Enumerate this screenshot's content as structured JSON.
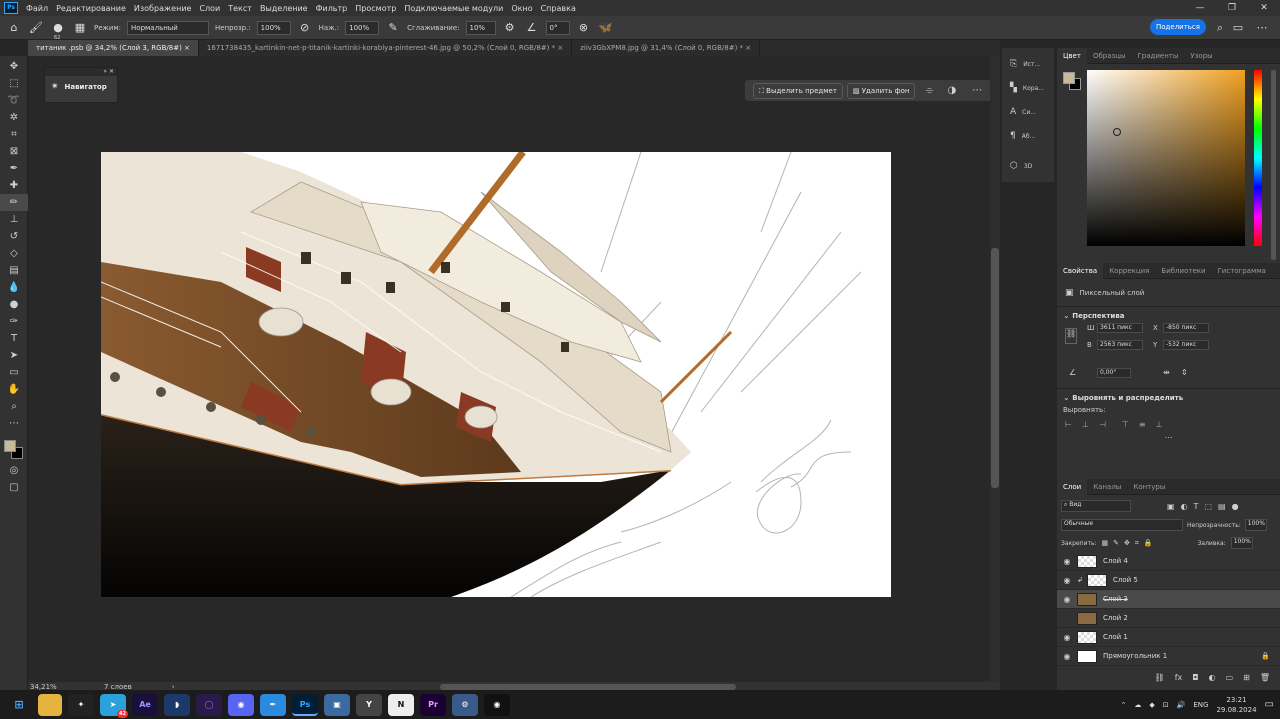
{
  "menubar": {
    "logo": "Ps",
    "items": [
      "Файл",
      "Редактирование",
      "Изображение",
      "Слои",
      "Текст",
      "Выделение",
      "Фильтр",
      "Просмотр",
      "Подключаемые модули",
      "Окно",
      "Справка"
    ]
  },
  "options": {
    "brush_size": "62",
    "mode_label": "Режим:",
    "mode_value": "Нормальный",
    "opacity_label": "Непрозр.:",
    "opacity_value": "100%",
    "flow_label": "Наж.:",
    "flow_value": "100%",
    "smoothing_label": "Сглаживание:",
    "smoothing_value": "10%",
    "angle_value": "0°",
    "share_label": "Поделиться"
  },
  "tabs": [
    {
      "label": "титаник .psb @ 34,2% (Слой 3, RGB/8#)"
    },
    {
      "label": "1671738435_kartinkin-net-p-titanik-kartinki-korablya-pinterest-46.jpg @ 50,2% (Слой 0, RGB/8#) *"
    },
    {
      "label": "ziiv3GbXPM8.jpg @ 31,4% (Слой 0, RGB/8#) *"
    }
  ],
  "navigator": {
    "title": "Навигатор"
  },
  "context_bar": {
    "select_subject": "Выделить предмет",
    "remove_bg": "Удалить фон"
  },
  "mid_panel": [
    {
      "label": "Ист...",
      "icon": "history-icon"
    },
    {
      "label": "Кора...",
      "icon": "brush-settings-icon"
    },
    {
      "label": "Си...",
      "icon": "character-icon"
    },
    {
      "label": "Аб...",
      "icon": "paragraph-icon"
    },
    {
      "label": "3D",
      "icon": "cube-icon"
    }
  ],
  "color_panel": {
    "tabs": [
      "Цвет",
      "Образцы",
      "Градиенты",
      "Узоры"
    ],
    "fg_color": "#c8b99a",
    "bg_color": "#000000",
    "hue_color": "#f0a020"
  },
  "properties": {
    "tabs": [
      "Свойства",
      "Коррекция",
      "Библиотеки",
      "Гистограмма"
    ],
    "layer_type": "Пиксельный слой",
    "transform_title": "Перспектива",
    "w_label": "Ш",
    "w_value": "3611 пикс",
    "x_label": "X",
    "x_value": "-850 пикс",
    "h_label": "В",
    "h_value": "2563 пикс",
    "y_label": "Y",
    "y_value": "-532 пикс",
    "angle_value": "0,00°",
    "align_title": "Выровнять и распределить",
    "align_label": "Выровнять:"
  },
  "layers": {
    "tabs": [
      "Слои",
      "Каналы",
      "Контуры"
    ],
    "filter": "Вид",
    "blend": "Обычные",
    "opacity_label": "Непрозрачность:",
    "opacity_value": "100%",
    "lock_label": "Закрепить:",
    "fill_label": "Заливка:",
    "fill_value": "100%",
    "items": [
      {
        "name": "Слой 4",
        "visible": true
      },
      {
        "name": "Слой 5",
        "visible": true
      },
      {
        "name": "Слой 3",
        "visible": true
      },
      {
        "name": "Слой 2",
        "visible": false
      },
      {
        "name": "Слой 1",
        "visible": true
      },
      {
        "name": "Прямоугольник 1",
        "visible": true
      }
    ]
  },
  "status": {
    "zoom": "34,21%",
    "info": "7 слоев"
  },
  "taskbar": {
    "lang": "ENG",
    "time": "23:21",
    "date": "29.08.2024",
    "badge": "42",
    "apps": [
      "Ae",
      "Ps",
      "Pr"
    ]
  }
}
